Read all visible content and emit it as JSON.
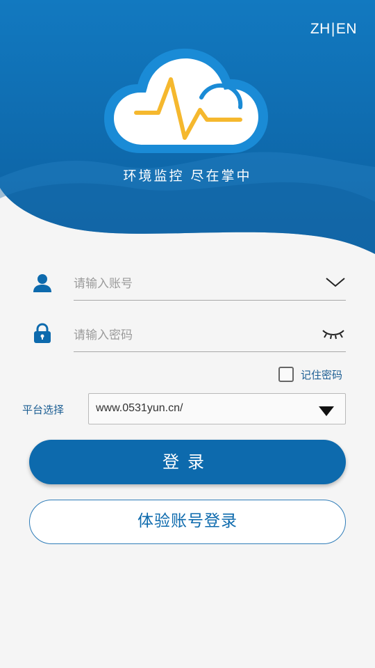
{
  "header": {
    "lang_zh": "ZH",
    "lang_sep": "|",
    "lang_en": "EN",
    "slogan": "环境监控 尽在掌中"
  },
  "form": {
    "account_placeholder": "请输入账号",
    "password_placeholder": "请输入密码",
    "remember_label": "记住密码",
    "remember_checked": false,
    "platform_label": "平台选择",
    "platform_value": "www.0531yun.cn/"
  },
  "buttons": {
    "login_label": "登录",
    "trial_label": "体验账号登录"
  },
  "icons": {
    "account": "user-icon",
    "password": "lock-icon",
    "account_dropdown": "chevron-down-icon",
    "password_toggle": "eye-closed-icon",
    "platform_dropdown": "triangle-down-icon",
    "logo": "cloud-pulse-logo"
  },
  "colors": {
    "primary": "#0d6aad",
    "header_blue": "#0f73b8",
    "label_blue": "#1c5e93",
    "logo_yellow": "#f5b82e"
  }
}
